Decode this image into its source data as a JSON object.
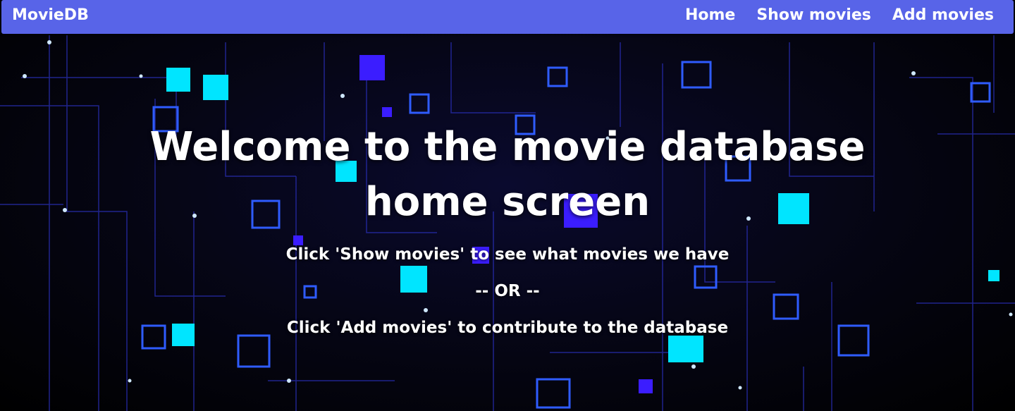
{
  "navbar": {
    "brand": "MovieDB",
    "links": [
      "Home",
      "Show movies",
      "Add movies"
    ],
    "color": "#5864e8"
  },
  "hero": {
    "title": "Welcome to the movie database home screen",
    "line_show": "Click 'Show movies' to see what movies we have",
    "line_or": "-- OR --",
    "line_add": "Click 'Add movies' to contribute to the database"
  }
}
